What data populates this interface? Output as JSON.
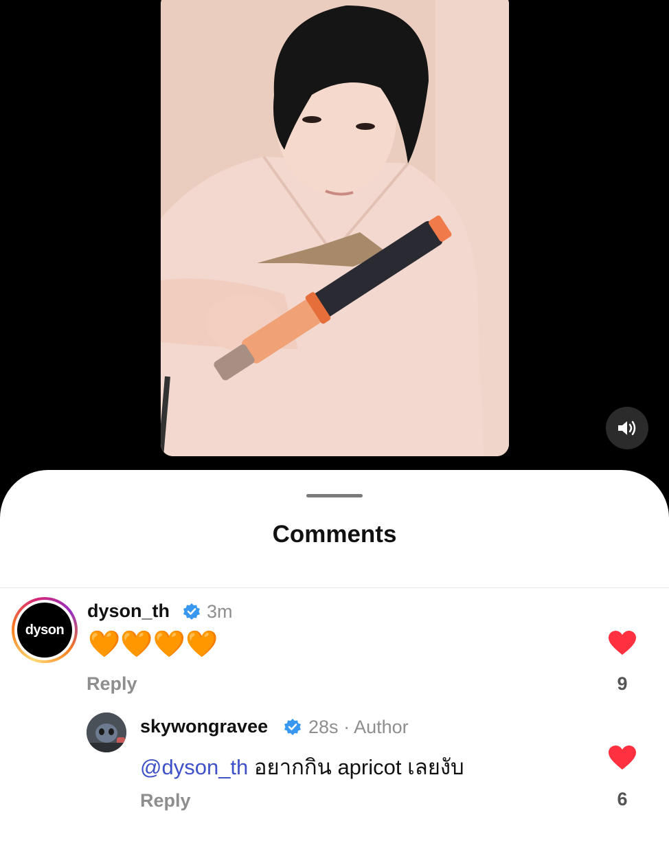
{
  "video": {
    "mute_icon": "speaker-icon"
  },
  "sheet": {
    "title": "Comments"
  },
  "comments": [
    {
      "username": "dyson_th",
      "verified": true,
      "time": "3m",
      "avatar_text": "dyson",
      "text_emoji": "🧡🧡🧡🧡",
      "reply_label": "Reply",
      "likes": "9"
    },
    {
      "username": "skywongravee",
      "verified": true,
      "time": "28s",
      "separator": "·",
      "author_badge": "Author",
      "mention": "@dyson_th",
      "text": " อยากกิน apricot เลยงับ",
      "reply_label": "Reply",
      "likes": "6"
    }
  ],
  "colors": {
    "heart": "#ff3040",
    "verified": "#3897f0",
    "mention": "#3f51c8"
  }
}
